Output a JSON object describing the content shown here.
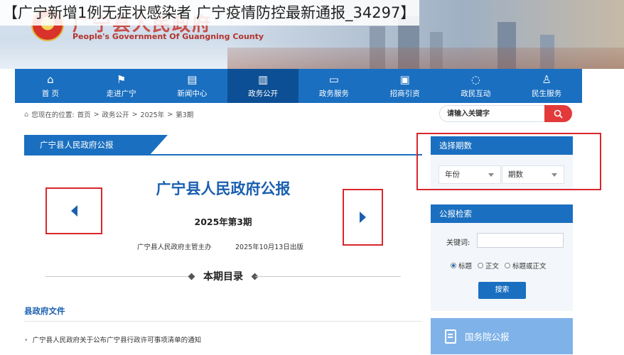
{
  "overlay_title": "【广宁新增1例无症状感染者  广宁疫情防控最新通报_34297】",
  "header": {
    "gov_name_cn": "广宁县人民政府",
    "gov_name_en": "People's Government Of Guangning County"
  },
  "nav": {
    "items": [
      {
        "icon": "⌂",
        "label": "首  页"
      },
      {
        "icon": "⚑",
        "label": "走进广宁"
      },
      {
        "icon": "▤",
        "label": "新闻中心"
      },
      {
        "icon": "▥",
        "label": "政务公开"
      },
      {
        "icon": "▭",
        "label": "政务服务"
      },
      {
        "icon": "▣",
        "label": "招商引资"
      },
      {
        "icon": "◌",
        "label": "政民互动"
      },
      {
        "icon": "♙",
        "label": "民生服务"
      }
    ],
    "active_index": 3
  },
  "breadcrumb": {
    "prefix": "您现在的位置:",
    "items": [
      "首页",
      "政务公开",
      "2025年",
      "第3期"
    ],
    "separator": ">"
  },
  "search": {
    "placeholder": "请输入关键字"
  },
  "main": {
    "tab_label": "广宁县人民政府公报",
    "journal_title": "广宁县人民政府公报",
    "issue": "2025年第3期",
    "publisher": "广宁县人民政府主管主办",
    "pub_date": "2025年10月13日出版",
    "toc_title": "本期目录",
    "section_title": "县政府文件",
    "documents": [
      "广宁县人民政府关于公布广宁县行政许可事项清单的通知"
    ]
  },
  "sidebar": {
    "period": {
      "title": "选择期数",
      "year_select": "年份",
      "issue_select": "期数"
    },
    "search": {
      "title": "公报检索",
      "keyword_label": "关键词:",
      "options": [
        "标题",
        "正文",
        "标题或正文"
      ],
      "selected_option": 0,
      "button": "搜索"
    },
    "state_council": "国务院公报"
  },
  "colors": {
    "primary": "#1a6fc0",
    "nav_active": "#0d4f95",
    "accent_red": "#e23a3a",
    "title_blue": "#1a5fb0"
  }
}
